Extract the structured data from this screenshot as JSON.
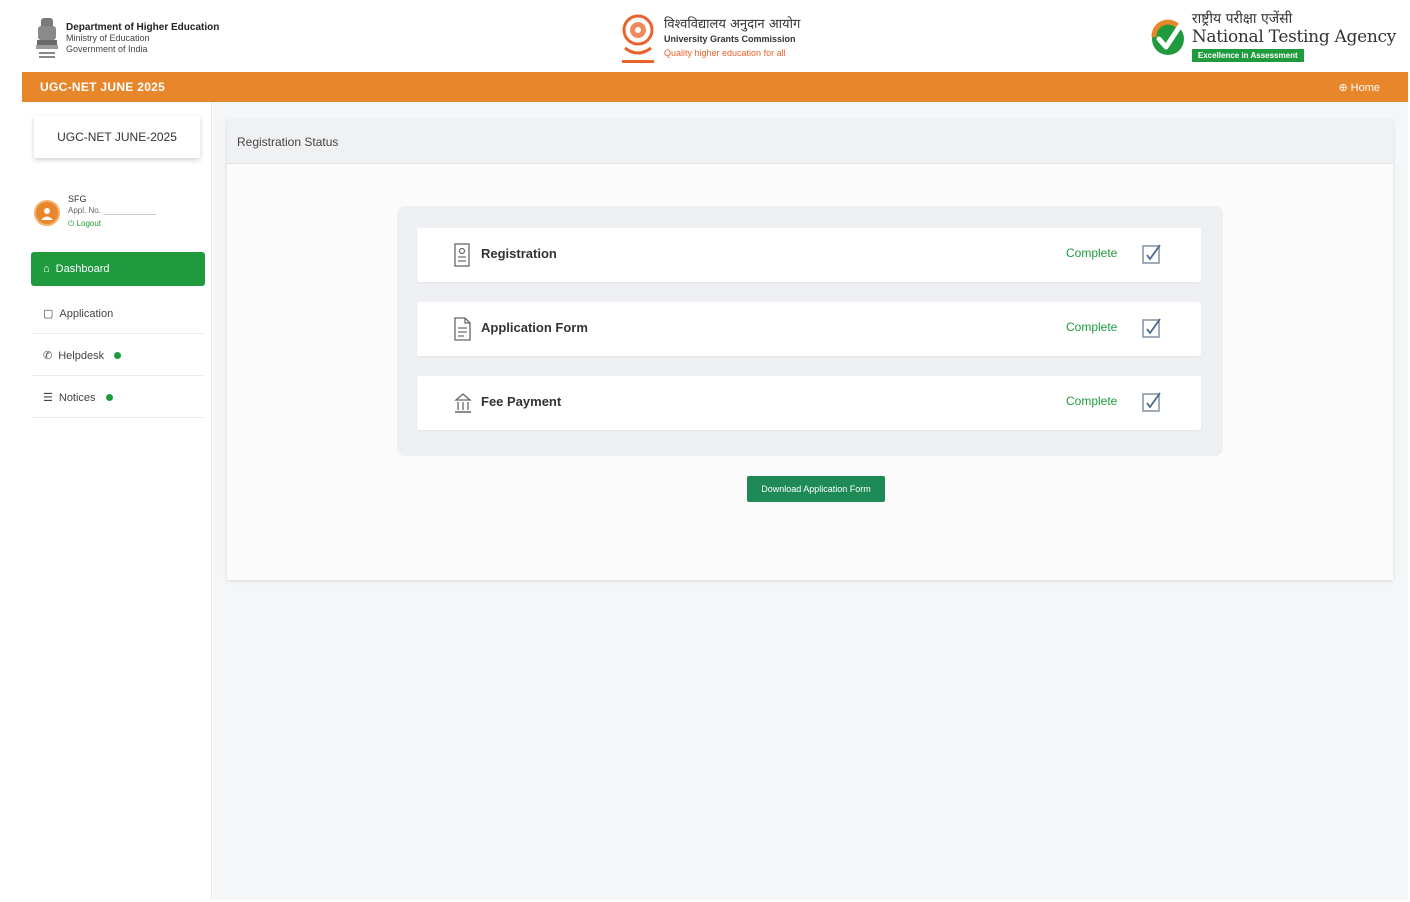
{
  "header": {
    "dhe_title": "Department of Higher Education",
    "dhe_ministry": "Ministry of Education",
    "dhe_govt": "Government of India",
    "ugc_hindi": "विश्वविद्यालय अनुदान आयोग",
    "ugc_english": "University Grants Commission",
    "ugc_tagline": "Quality higher education for all",
    "nta_hindi": "राष्ट्रीय परीक्षा एजेंसी",
    "nta_english": "National Testing Agency",
    "nta_tagline": "Excellence in Assessment"
  },
  "topbar": {
    "title": "UGC-NET JUNE 2025",
    "home_label": "Home"
  },
  "sidebar": {
    "exam_title": "UGC-NET JUNE-2025",
    "user_name": "SFG",
    "app_no_label": "Appl. No.",
    "logout_label": "Logout",
    "items": [
      {
        "label": "Dashboard",
        "active": true
      },
      {
        "label": "Application"
      },
      {
        "label": "Helpdesk",
        "has_dot": true
      },
      {
        "label": "Notices",
        "has_dot": true
      }
    ]
  },
  "main": {
    "panel_title": "Registration Status",
    "steps": [
      {
        "label": "Registration",
        "status": "Complete",
        "icon": "registration-icon"
      },
      {
        "label": "Application Form",
        "status": "Complete",
        "icon": "application-form-icon"
      },
      {
        "label": "Fee Payment",
        "status": "Complete",
        "icon": "fee-payment-icon"
      }
    ],
    "download_button": "Download Application Form"
  },
  "colors": {
    "orange": "#e8862b",
    "green": "#1f9b3e",
    "button_green": "#1e8a56"
  }
}
